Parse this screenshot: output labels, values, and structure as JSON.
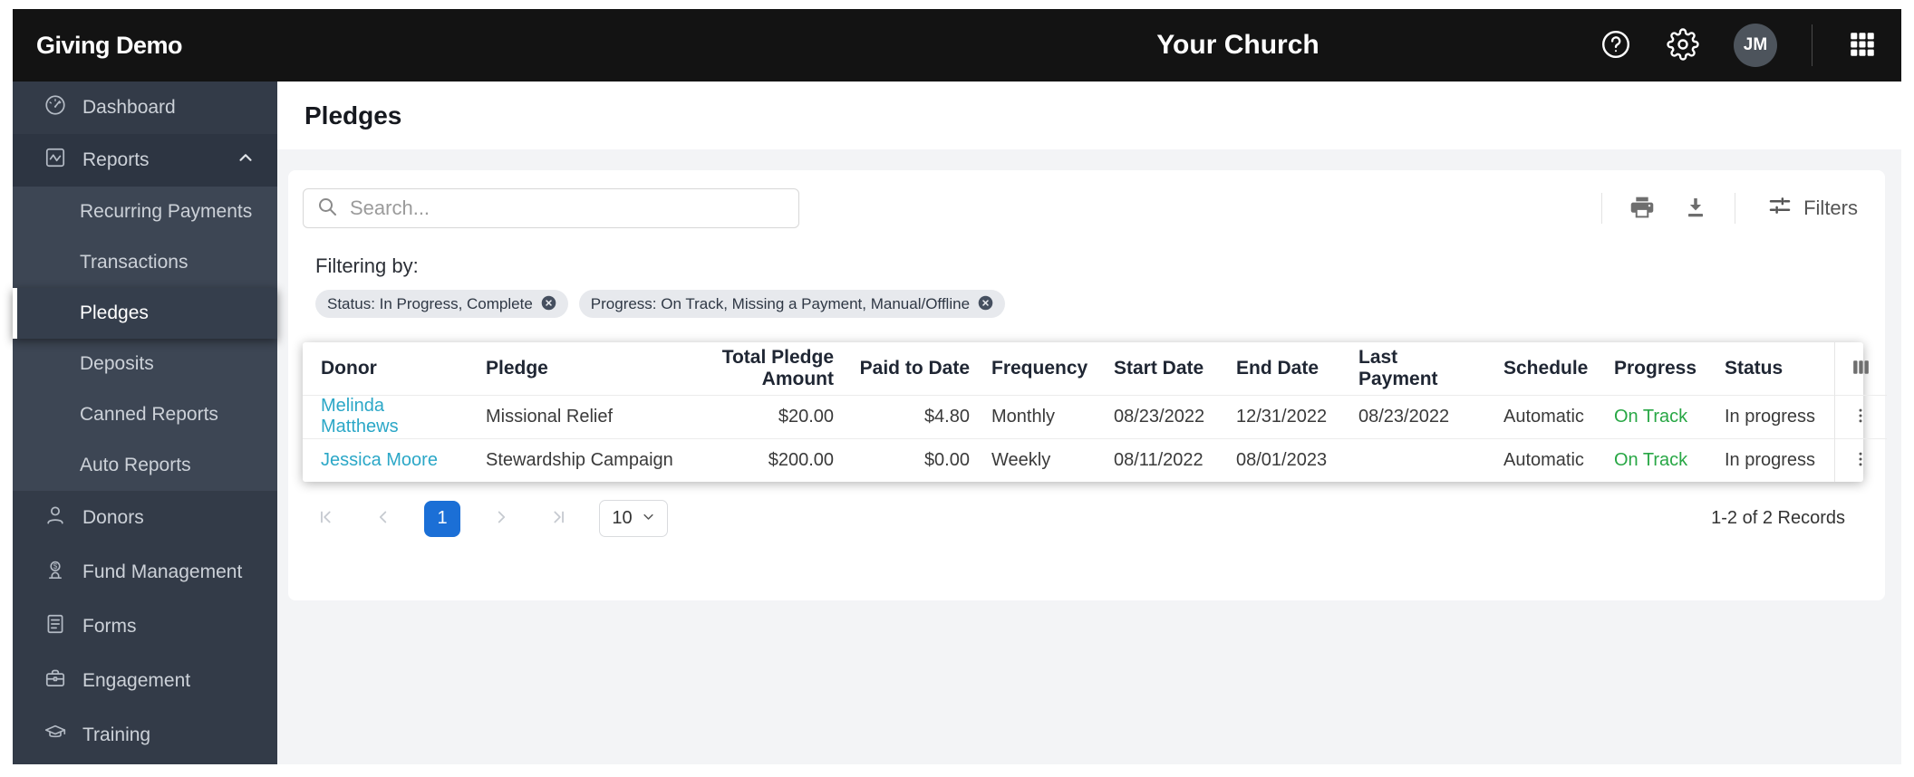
{
  "colors": {
    "header_bg": "#131313",
    "sidebar_bg": "#333b48",
    "sidebar_submenu_bg": "#3d4654",
    "content_bg": "#f3f4f6",
    "accent_blue": "#1b6fd6",
    "link_teal": "#2ba7c7",
    "success_green": "#28a745"
  },
  "icons": [
    "help-icon",
    "settings-gear-icon",
    "apps-grid-icon",
    "dashboard-gauge-icon",
    "reports-chart-icon",
    "chevron-up-icon",
    "person-icon",
    "fund-donation-icon",
    "document-icon",
    "briefcase-icon",
    "graduation-cap-icon",
    "search-icon",
    "print-icon",
    "download-icon",
    "filter-sliders-icon",
    "chip-close-icon",
    "columns-icon",
    "kebab-menu-icon",
    "first-page-icon",
    "prev-page-icon",
    "next-page-icon",
    "last-page-icon",
    "chevron-down-icon"
  ],
  "header": {
    "logo": "Giving Demo",
    "title": "Your Church",
    "avatar_initials": "JM"
  },
  "sidebar": {
    "items": [
      {
        "label": "Dashboard"
      },
      {
        "label": "Reports",
        "expanded": true
      },
      {
        "label": "Recurring Payments",
        "submenu": true
      },
      {
        "label": "Transactions",
        "submenu": true
      },
      {
        "label": "Pledges",
        "submenu": true,
        "selected": true
      },
      {
        "label": "Deposits",
        "submenu": true
      },
      {
        "label": "Canned Reports",
        "submenu": true
      },
      {
        "label": "Auto Reports",
        "submenu": true
      },
      {
        "label": "Donors"
      },
      {
        "label": "Fund Management"
      },
      {
        "label": "Forms"
      },
      {
        "label": "Engagement"
      },
      {
        "label": "Training"
      }
    ]
  },
  "page": {
    "title": "Pledges"
  },
  "toolbar": {
    "search_placeholder": "Search...",
    "filters_label": "Filters"
  },
  "filters": {
    "label": "Filtering by:",
    "chips": [
      {
        "label": "Status: In Progress, Complete"
      },
      {
        "label": "Progress: On Track, Missing a Payment, Manual/Offline"
      }
    ]
  },
  "table": {
    "columns": [
      "Donor",
      "Pledge",
      "Total Pledge Amount",
      "Paid to Date",
      "Frequency",
      "Start Date",
      "End Date",
      "Last Payment",
      "Schedule",
      "Progress",
      "Status"
    ],
    "rows": [
      {
        "donor": "Melinda Matthews",
        "pledge": "Missional Relief",
        "total": "$20.00",
        "paid": "$4.80",
        "frequency": "Monthly",
        "start_date": "08/23/2022",
        "end_date": "12/31/2022",
        "last_payment": "08/23/2022",
        "schedule": "Automatic",
        "progress": "On Track",
        "status": "In progress"
      },
      {
        "donor": "Jessica Moore",
        "pledge": "Stewardship Campaign",
        "total": "$200.00",
        "paid": "$0.00",
        "frequency": "Weekly",
        "start_date": "08/11/2022",
        "end_date": "08/01/2023",
        "last_payment": "",
        "schedule": "Automatic",
        "progress": "On Track",
        "status": "In progress"
      }
    ]
  },
  "pagination": {
    "current_page": "1",
    "page_size": "10",
    "records_text": "1-2 of 2 Records"
  }
}
